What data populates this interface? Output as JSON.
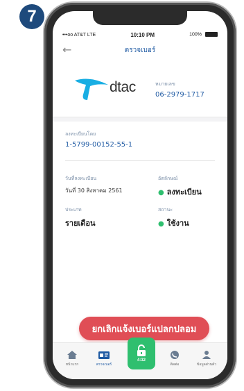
{
  "step_number": "7",
  "status_bar": {
    "carrier": "•••oo AT&T LTE",
    "time": "10:10 PM",
    "battery": "100%"
  },
  "header": {
    "title": "ตรวจเบอร์"
  },
  "provider": {
    "brand": "dtac",
    "number_label": "หมายเลข",
    "number": "06-2979-1717"
  },
  "registration": {
    "id_label": "ลงทะเบียนโดย",
    "id_value": "1-5799-00152-55-1",
    "date_label": "วันที่ลงทะเบียน",
    "date_value": "วันที่ 30 สิงหาคม 2561",
    "id_status_label": "อัตลักษณ์",
    "id_status_value": "ลงทะเบียน",
    "type_label": "ประเภท",
    "type_value": "รายเดือน",
    "status_label": "สถานะ",
    "status_value": "ใช้งาน"
  },
  "cancel_button": "ยกเลิกแจ้งเบอร์แปลกปลอม",
  "tabs": {
    "home": "หน้าแรก",
    "check": "ตรวจเบอร์",
    "center_time": "4:32",
    "contact": "ติดต่อ",
    "profile": "ข้อมูลส่วนตัว"
  },
  "colors": {
    "accent": "#1f5aa3",
    "danger": "#e04e56",
    "success": "#2fbf6f",
    "brand_blue": "#19aee3"
  }
}
